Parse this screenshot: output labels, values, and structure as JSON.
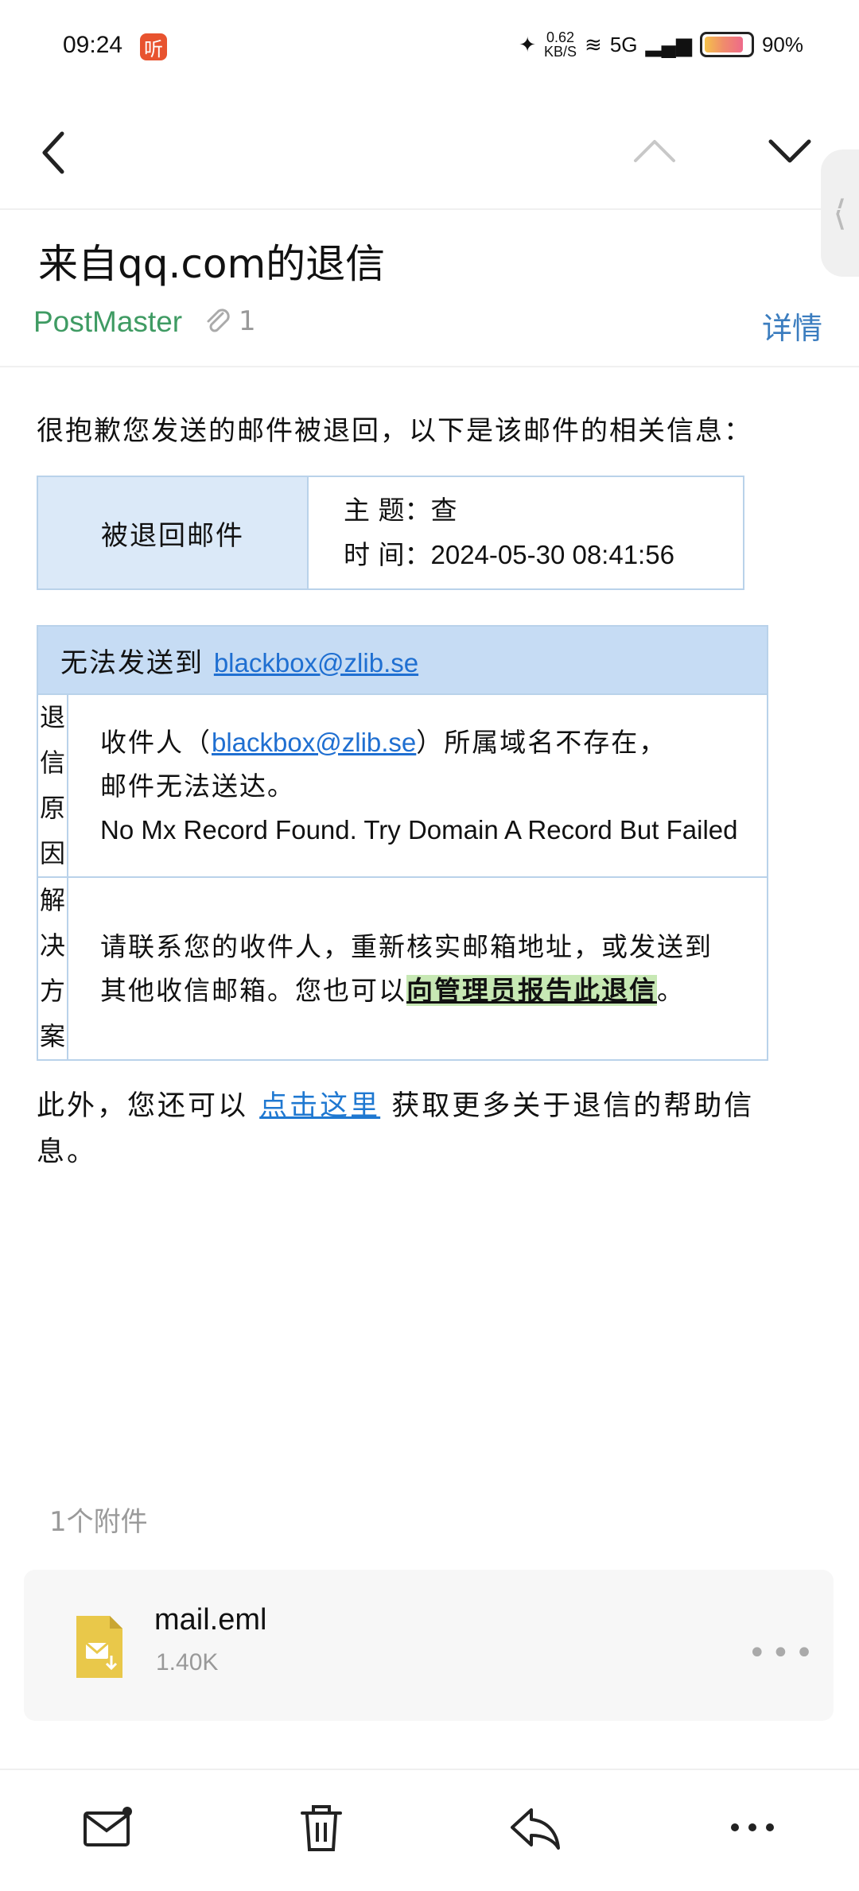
{
  "status_bar": {
    "time": "09:24",
    "app_badge": "听",
    "net_speed": "0.62",
    "net_unit": "KB/S",
    "signal": "5G",
    "battery": "90%"
  },
  "email": {
    "subject": "来自qq.com的退信",
    "sender": "PostMaster",
    "attachment_count": "1",
    "details_label": "详情",
    "intro": "很抱歉您发送的邮件被退回，以下是该邮件的相关信息：",
    "returned_label": "被退回邮件",
    "subject_line": "主 题：查",
    "time_label": "时 间：",
    "time_value": "2024-05-30 08:41:56",
    "cannot_send_prefix": "无法发送到 ",
    "recipient": "blackbox@zlib.se",
    "reason_side": [
      "退",
      "信",
      "原",
      "因"
    ],
    "reason_prefix": "收件人（",
    "reason_suffix": "）所属域名不存在，",
    "reason_line2": "邮件无法送达。",
    "reason_en": "No Mx Record Found. Try Domain A Record But Failed",
    "solution_side": [
      "解",
      "决",
      "方",
      "案"
    ],
    "solution_text1": "请联系您的收件人，重新核实邮箱地址，或发送到其他收信邮箱。您也可以",
    "solution_link": "向管理员报告此退信",
    "solution_end": "。",
    "more_prefix": "此外，您还可以 ",
    "more_link": "点击这里",
    "more_suffix": " 获取更多关于退信的帮助信息。"
  },
  "attachments": {
    "count_label": "1个附件",
    "items": [
      {
        "name": "mail.eml",
        "size": "1.40K"
      }
    ]
  },
  "icons": {
    "back": "chevron-left-icon",
    "prev": "chevron-up-icon",
    "next": "chevron-down-icon",
    "compose": "mail-icon",
    "delete": "trash-icon",
    "reply": "reply-icon",
    "more": "more-icon"
  },
  "colors": {
    "sender": "#3f9b63",
    "link": "#1f6fd1",
    "table_border": "#b9d2ea",
    "table_header": "#c6dcf4"
  }
}
